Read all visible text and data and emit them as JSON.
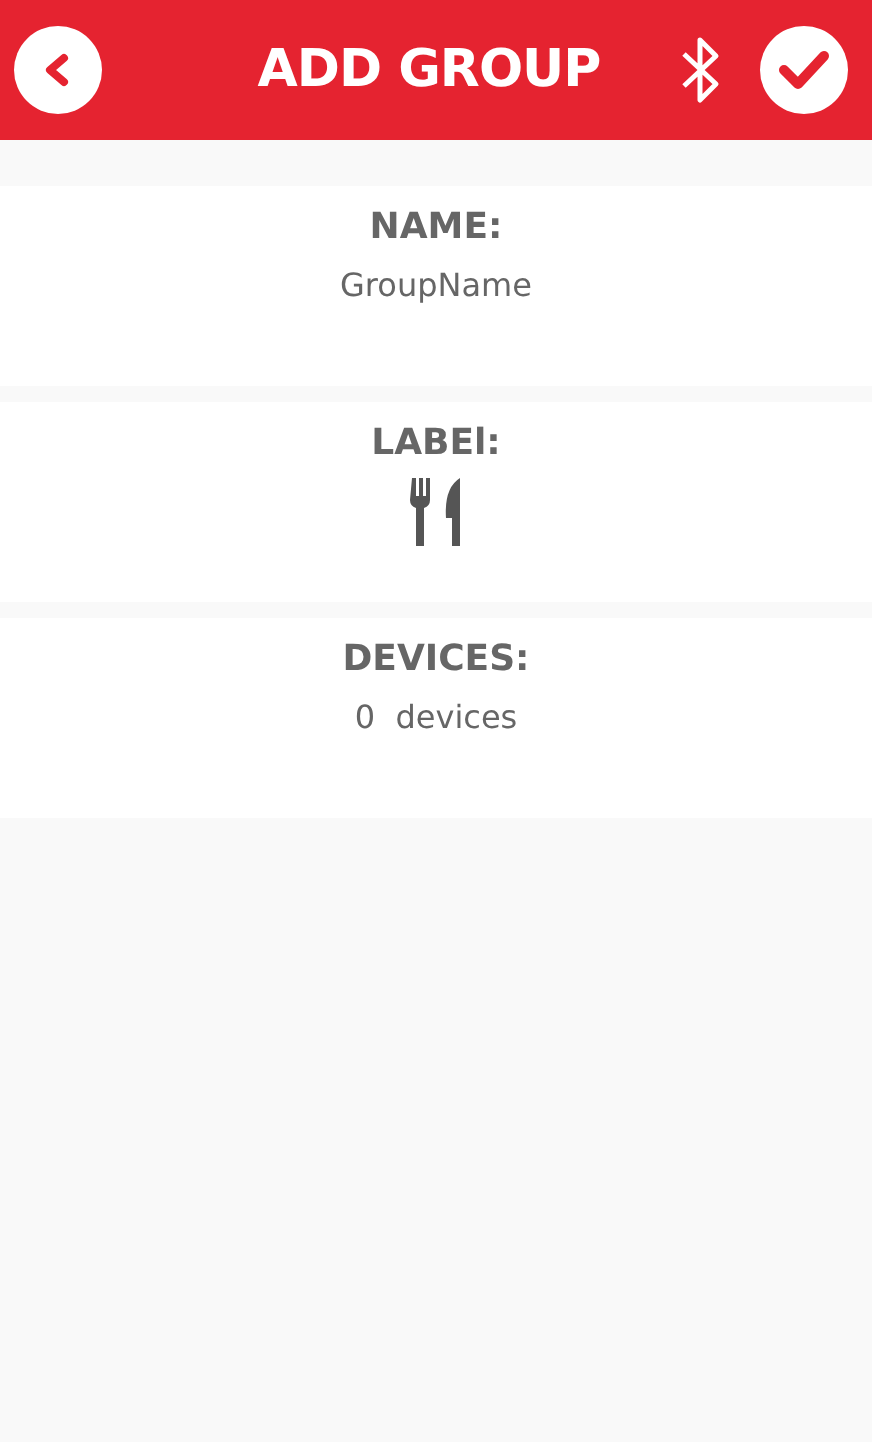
{
  "header": {
    "title": "ADD GROUP"
  },
  "sections": [
    {
      "kind": "text",
      "label": "NAME:",
      "value": "GroupName"
    },
    {
      "kind": "icon",
      "label": "LABEl:"
    },
    {
      "kind": "text",
      "label": "DEVICES:",
      "value": "0  devices"
    }
  ]
}
